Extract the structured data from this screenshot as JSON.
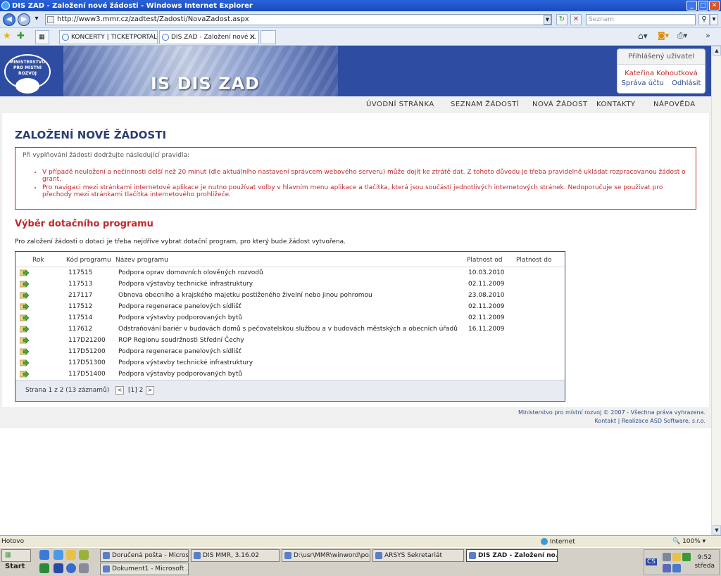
{
  "window": {
    "title": "DIS ZAD - Založení nové žádosti - Windows Internet Explorer"
  },
  "browser": {
    "url": "http://www3.mmr.cz/zadtest/Zadosti/NovaZadost.aspx",
    "search_placeholder": "Seznam",
    "tabs": [
      {
        "label": "KONCERTY | TICKETPORTAL..."
      },
      {
        "label": "DIS ZAD - Založení nové ..."
      }
    ]
  },
  "header": {
    "logo_text": "MINISTERSTVO PRO MÍSTNÍ ROZVOJ",
    "app_name": "IS DIS ZAD",
    "user_box": {
      "title": "Přihlášený uživatel",
      "user_name": "Kateřina Kohoutková",
      "account_link": "Správa účtu",
      "logout_link": "Odhlásit"
    }
  },
  "menu": {
    "items": [
      "ÚVODNÍ STRÁNKA",
      "SEZNAM ŽÁDOSTÍ",
      "NOVÁ ŽÁDOST",
      "KONTAKTY",
      "NÁPOVĚDA"
    ]
  },
  "main": {
    "title": "ZALOŽENÍ NOVÉ ŽÁDOSTI",
    "rules_intro": "Při vyplňování žádosti dodržujte následující pravidla:",
    "rules": [
      "V případě neuložení a nečinnosti delší než 20 minut (dle aktuálního nastavení správcem webového serveru) může dojít ke ztrátě dat. Z tohoto důvodu je třeba pravidelně ukládat rozpracovanou žádost o grant.",
      "Pro navigaci mezi stránkami internetové aplikace je nutno používat volby v hlavním menu aplikace a tlačítka, která jsou součástí jednotlivých internetových stránek. Nedoporučuje se používat pro přechody mezi stránkami tlačítka internetového prohlížeče."
    ],
    "section_title": "Výběr dotačního programu",
    "section_desc": "Pro založení žádosti o dotaci je třeba nejdříve vybrat dotační program, pro který bude žádost vytvořena."
  },
  "grid": {
    "columns": [
      "Rok",
      "Kód programu",
      "Název programu",
      "Platnost od",
      "Platnost do"
    ],
    "rows": [
      {
        "code": "117515",
        "name": "Podpora oprav domovních olověných rozvodů",
        "from": "10.03.2010",
        "to": ""
      },
      {
        "code": "117513",
        "name": "Podpora výstavby technické infrastruktury",
        "from": "02.11.2009",
        "to": ""
      },
      {
        "code": "217117",
        "name": "Obnova obecního a krajského majetku postiženého živelní nebo jinou pohromou",
        "from": "23.08.2010",
        "to": ""
      },
      {
        "code": "117512",
        "name": "Podpora regenerace panelových sídlišť",
        "from": "02.11.2009",
        "to": ""
      },
      {
        "code": "117514",
        "name": "Podpora výstavby podporovaných bytů",
        "from": "02.11.2009",
        "to": ""
      },
      {
        "code": "117612",
        "name": "Odstraňování bariér v budovách domů s pečovatelskou službou a v budovách městských a obecních úřadů",
        "from": "16.11.2009",
        "to": ""
      },
      {
        "code": "117D21200",
        "name": "ROP Regionu soudržnosti Střední Čechy",
        "from": "",
        "to": ""
      },
      {
        "code": "117D51200",
        "name": "Podpora regenerace panelových sídlišť",
        "from": "",
        "to": ""
      },
      {
        "code": "117D51300",
        "name": "Podpora výstavby technické infrastruktury",
        "from": "",
        "to": ""
      },
      {
        "code": "117D51400",
        "name": "Podpora výstavby podporovaných bytů",
        "from": "",
        "to": ""
      }
    ],
    "pager": {
      "text": "Strana 1 z 2 (13 záznamů)",
      "prev": "<",
      "pages": "[1] 2",
      "next": ">"
    }
  },
  "footer": {
    "line1": "Ministerstvo pro místní rozvoj © 2007 - Všechna práva vyhrazena.",
    "line2": "Kontakt | Realizace ASD Software, s.r.o."
  },
  "statusbar": {
    "status": "Hotovo",
    "zone": "Internet",
    "zoom": "100%"
  },
  "taskbar": {
    "start": "Start",
    "buttons_row1": [
      "Doručená pošta - Micros...",
      "DIS MMR, 3.16.02",
      "D:\\usr\\MMR\\winword\\po...",
      "ARSYS Sekretariát",
      "DIS ZAD - Založení no..."
    ],
    "buttons_row2": [
      "Dokument1 - Microsoft ..."
    ],
    "tray_lang": "CS",
    "clock_time": "9:52",
    "clock_day": "středa"
  },
  "colors": {
    "accent": "#2e4da2",
    "warning": "#c0282d",
    "title": "#2b3f70"
  }
}
